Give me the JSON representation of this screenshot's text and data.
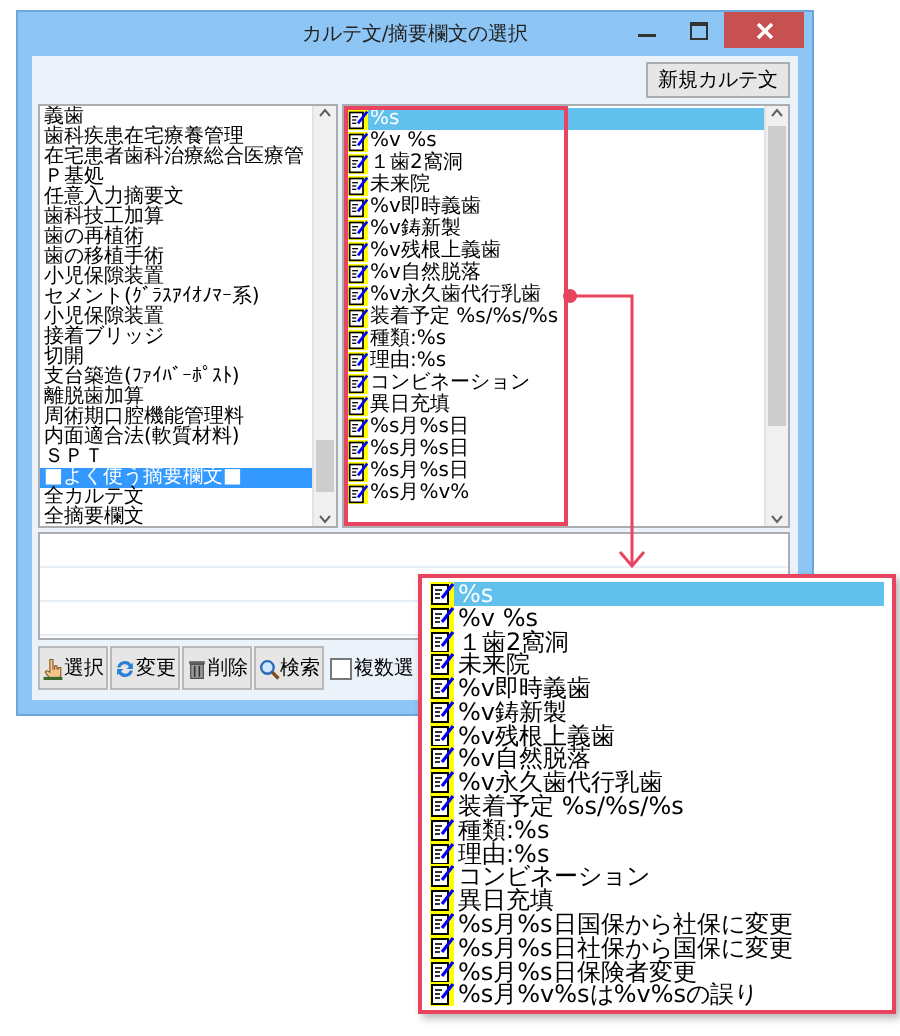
{
  "window": {
    "title": "カルテ文/摘要欄文の選択"
  },
  "new_button": "新規カルテ文",
  "categories": [
    {
      "label": "義歯",
      "selected": false
    },
    {
      "label": "歯科疾患在宅療養管理",
      "selected": false
    },
    {
      "label": "在宅患者歯科治療総合医療管",
      "selected": false
    },
    {
      "label": "Ｐ基処",
      "selected": false
    },
    {
      "label": "任意入力摘要文",
      "selected": false
    },
    {
      "label": "歯科技工加算",
      "selected": false
    },
    {
      "label": "歯の再植術",
      "selected": false
    },
    {
      "label": "歯の移植手術",
      "selected": false
    },
    {
      "label": "小児保隙装置",
      "selected": false
    },
    {
      "label": "セメント(ｸﾞﾗｽｱｲｵﾉﾏｰ系)",
      "selected": false
    },
    {
      "label": "小児保隙装置",
      "selected": false
    },
    {
      "label": "接着ブリッジ",
      "selected": false
    },
    {
      "label": "切開",
      "selected": false
    },
    {
      "label": "支台築造(ﾌｧｲﾊﾞｰﾎﾟｽﾄ)",
      "selected": false
    },
    {
      "label": "離脱歯加算",
      "selected": false
    },
    {
      "label": "周術期口腔機能管理料",
      "selected": false
    },
    {
      "label": "内面適合法(軟質材料)",
      "selected": false
    },
    {
      "label": "ＳＰＴ",
      "selected": false
    },
    {
      "label": "■よく使う摘要欄文■",
      "selected": true
    },
    {
      "label": "全カルテ文",
      "selected": false
    },
    {
      "label": "全摘要欄文",
      "selected": false
    }
  ],
  "phrases": [
    {
      "label": "%s",
      "selected": true
    },
    {
      "label": "%v %s",
      "selected": false
    },
    {
      "label": "１歯2窩洞",
      "selected": false
    },
    {
      "label": "未来院",
      "selected": false
    },
    {
      "label": "%v即時義歯",
      "selected": false
    },
    {
      "label": "%v鋳新製",
      "selected": false
    },
    {
      "label": "%v残根上義歯",
      "selected": false
    },
    {
      "label": "%v自然脱落",
      "selected": false
    },
    {
      "label": "%v永久歯代行乳歯",
      "selected": false
    },
    {
      "label": "装着予定 %s/%s/%s",
      "selected": false
    },
    {
      "label": "種類:%s",
      "selected": false
    },
    {
      "label": "理由:%s",
      "selected": false
    },
    {
      "label": "コンビネーション",
      "selected": false
    },
    {
      "label": "異日充填",
      "selected": false
    },
    {
      "label": "%s月%s日",
      "selected": false
    },
    {
      "label": "%s月%s日",
      "selected": false
    },
    {
      "label": "%s月%s日",
      "selected": false
    },
    {
      "label": "%s月%v%",
      "selected": false
    }
  ],
  "toolbar": [
    {
      "kind": "select",
      "label": "選択"
    },
    {
      "kind": "change",
      "label": "変更"
    },
    {
      "kind": "delete",
      "label": "削除"
    },
    {
      "kind": "search",
      "label": "検索"
    }
  ],
  "multi_select": {
    "label": "複数選",
    "checked": false
  },
  "callout": {
    "items": [
      {
        "label": "%s",
        "selected": true
      },
      {
        "label": "%v %s",
        "selected": false
      },
      {
        "label": "１歯2窩洞",
        "selected": false
      },
      {
        "label": "未来院",
        "selected": false
      },
      {
        "label": "%v即時義歯",
        "selected": false
      },
      {
        "label": "%v鋳新製",
        "selected": false
      },
      {
        "label": "%v残根上義歯",
        "selected": false
      },
      {
        "label": "%v自然脱落",
        "selected": false
      },
      {
        "label": "%v永久歯代行乳歯",
        "selected": false
      },
      {
        "label": "装着予定 %s/%s/%s",
        "selected": false
      },
      {
        "label": "種類:%s",
        "selected": false
      },
      {
        "label": "理由:%s",
        "selected": false
      },
      {
        "label": "コンビネーション",
        "selected": false
      },
      {
        "label": "異日充填",
        "selected": false
      },
      {
        "label": "%s月%s日国保から社保に変更",
        "selected": false
      },
      {
        "label": "%s月%s日社保から国保に変更",
        "selected": false
      },
      {
        "label": "%s月%s日保険者変更",
        "selected": false
      },
      {
        "label": "%s月%v%sは%v%sの誤り",
        "selected": false
      }
    ]
  }
}
